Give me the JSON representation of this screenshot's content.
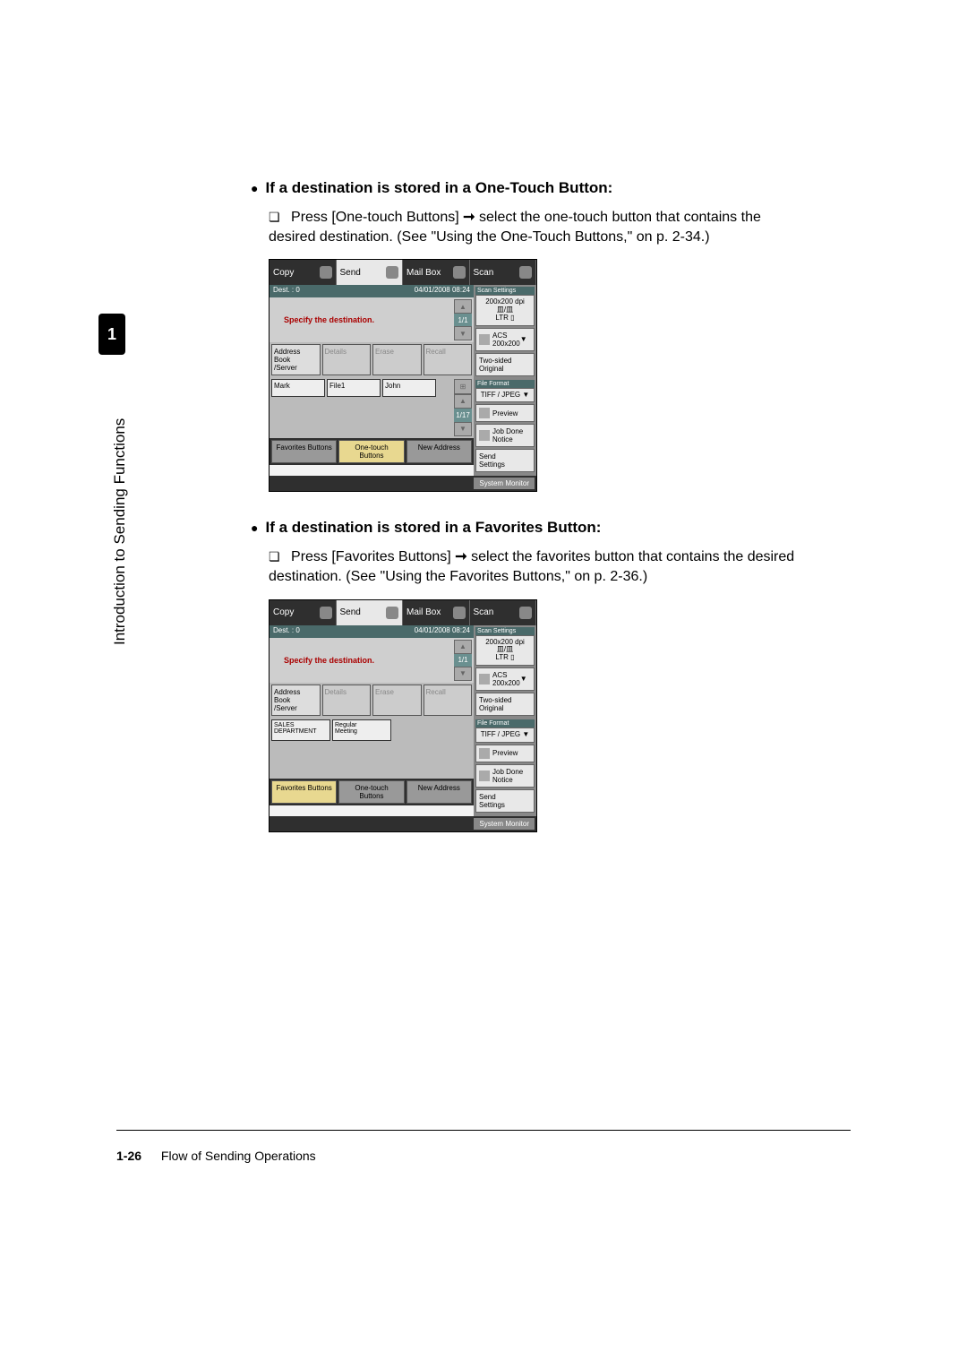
{
  "chapter": "1",
  "sidebar_text": "Introduction to Sending Functions",
  "heading1": "If a destination is stored in a One-Touch Button:",
  "instruction1_a": "Press [One-touch Buttons]",
  "instruction1_b": "select the one-touch button that contains the desired destination. (See \"Using the One-Touch Buttons,\" on p. 2-34.)",
  "heading2": "If a destination is stored in a Favorites Button:",
  "instruction2_a": "Press [Favorites Buttons]",
  "instruction2_b": "select the favorites button that contains the desired destination. (See \"Using the Favorites Buttons,\" on p. 2-36.)",
  "panel": {
    "tabs": {
      "copy": "Copy",
      "send": "Send",
      "mailbox": "Mail Box",
      "scan": "Scan"
    },
    "dest_bar_left": "Dest. :   0",
    "dest_bar_right": "04/01/2008 08:24",
    "dest_msg": "Specify the destination.",
    "page_dest": "1/1",
    "address_book": "Address Book\n/Server",
    "details": "Details",
    "erase": "Erase",
    "recall": "Recall",
    "onetouch": {
      "mark": "Mark",
      "file1": "File1",
      "john": "John"
    },
    "fav": {
      "sales": "SALES\nDEPARTMENT",
      "regular": "Regular\nMeeting"
    },
    "page_touch": "1/17",
    "bottom": {
      "fav": "Favorites Buttons",
      "one": "One-touch Buttons",
      "new": "New Address"
    },
    "scan_settings_label": "Scan Settings",
    "res": "200x200 dpi",
    "detect": "皿/皿",
    "ltr": "LTR",
    "acs": "ACS\n200x200",
    "twosided": "Two-sided\nOriginal",
    "file_format_label": "File Format",
    "file_format": "TIFF / JPEG",
    "preview": "Preview",
    "jobdone": "Job Done\nNotice",
    "sendsettings": "Send\nSettings",
    "sysmon": "System Monitor"
  },
  "footer": {
    "page": "1-26",
    "title": "Flow of Sending Operations"
  }
}
